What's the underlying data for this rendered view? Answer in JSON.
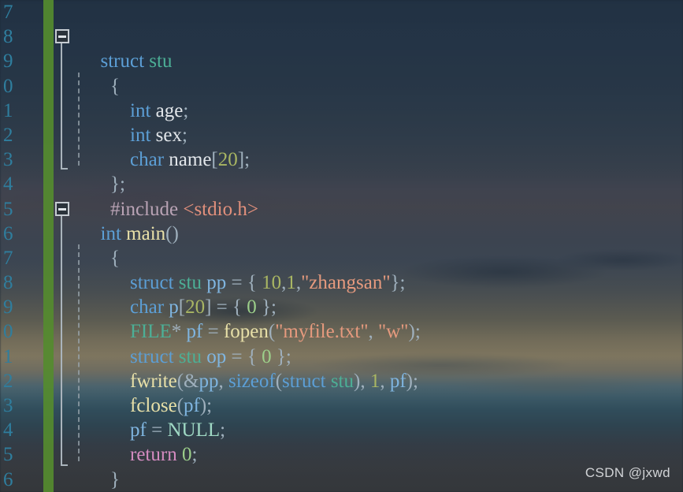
{
  "editor": {
    "language": "C",
    "theme_accent": "#558b2f",
    "gutter": {
      "change_marker_color": "#558b2f",
      "line_number_color": "#2f7e9e",
      "line_numbers": [
        "7",
        "8",
        "9",
        "0",
        "1",
        "2",
        "3",
        "4",
        "5",
        "6",
        "7",
        "8",
        "9",
        "0",
        "1",
        "2",
        "3",
        "4",
        "5",
        "6"
      ]
    },
    "fold_markers": [
      {
        "line_index": 1,
        "state": "expanded",
        "glyph": "minus"
      },
      {
        "line_index": 8,
        "state": "expanded",
        "glyph": "minus"
      }
    ],
    "lines": [
      {
        "n": "7",
        "text": ""
      },
      {
        "n": "8",
        "text": "struct stu"
      },
      {
        "n": "9",
        "text": "{"
      },
      {
        "n": "0",
        "text": "    int age;"
      },
      {
        "n": "1",
        "text": "    int sex;"
      },
      {
        "n": "2",
        "text": "    char name[20];"
      },
      {
        "n": "3",
        "text": "};"
      },
      {
        "n": "4",
        "text": "#include <stdio.h>"
      },
      {
        "n": "5",
        "text": "int main()"
      },
      {
        "n": "6",
        "text": "{"
      },
      {
        "n": "7",
        "text": "    struct stu pp = { 10,1,\"zhangsan\"};"
      },
      {
        "n": "8",
        "text": "    char p[20] = { 0 };"
      },
      {
        "n": "9",
        "text": "    FILE* pf = fopen(\"myfile.txt\", \"w\");"
      },
      {
        "n": "0",
        "text": "    struct stu op = { 0 };"
      },
      {
        "n": "1",
        "text": "    fwrite(&pp, sizeof(struct stu), 1, pf);"
      },
      {
        "n": "2",
        "text": "    fclose(pf);"
      },
      {
        "n": "3",
        "text": "    pf = NULL;"
      },
      {
        "n": "4",
        "text": "    return 0;"
      },
      {
        "n": "5",
        "text": "}"
      },
      {
        "n": "6",
        "text": ""
      }
    ],
    "syntax_colors": {
      "keyword": "#5c9fd6",
      "user_type": "#4caf96",
      "function": "#e8e0a8",
      "number": "#a9b663",
      "string": "#e69a7e",
      "preprocessor": "#b9a3b5",
      "include_path": "#e2907c",
      "return_keyword": "#d48bc0",
      "null_literal": "#9fd8c4",
      "identifier": "#e2e6ea",
      "punctuation": "#9fb0bd"
    }
  },
  "watermark": {
    "text": "CSDN @jxwd"
  }
}
